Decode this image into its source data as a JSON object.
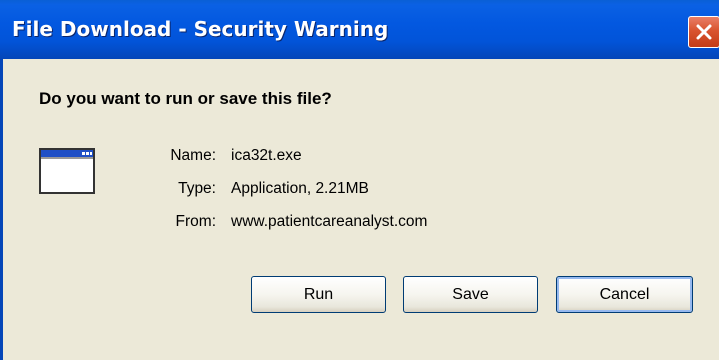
{
  "window": {
    "title": "File Download - Security Warning"
  },
  "dialog": {
    "question": "Do you want to run or save this file?",
    "fields": [
      {
        "label": "Name:",
        "value": "ica32t.exe"
      },
      {
        "label": "Type:",
        "value": "Application, 2.21MB"
      },
      {
        "label": "From:",
        "value": "www.patientcareanalyst.com"
      }
    ]
  },
  "buttons": {
    "run_label": "Run",
    "save_label": "Save",
    "cancel_label": "Cancel"
  },
  "icons": {
    "close": "close-icon",
    "file": "application-window-icon"
  },
  "colors": {
    "titlebar": "#0358e0",
    "dialog_bg": "#ece9d8",
    "close_button": "#d9542f"
  }
}
